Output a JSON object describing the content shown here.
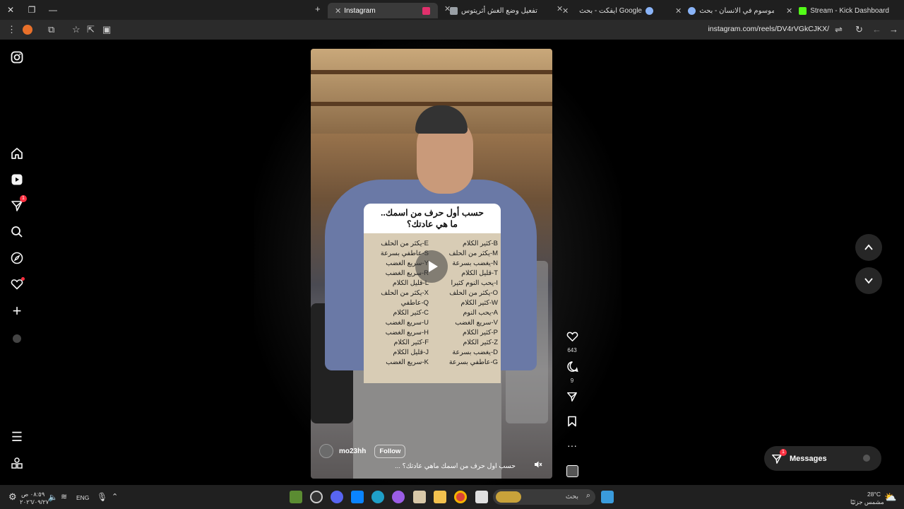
{
  "browser": {
    "tabs": [
      {
        "label": "Stream - Kick Dashboard",
        "color": "#53fc18"
      },
      {
        "label": "كم كروموسوم في الانسان - بحث",
        "color": "#8ab4f8"
      },
      {
        "label": "ايفكت - بحث Google",
        "color": "#8ab4f8"
      },
      {
        "label": "تفعيل وضع الغش أثريتوس",
        "color": "#9aa0a6"
      },
      {
        "label": "Instagram",
        "color": "#e1306c"
      }
    ],
    "url": "instagram.com/reels/DV4rVGkCJKX/"
  },
  "nav": {
    "notifications_badge": "1"
  },
  "reel": {
    "card_title_line1": "حسب أول حرف من اسمك..",
    "card_title_line2": "ما هي عادتك؟",
    "right_column": [
      "B-كثير الكلام",
      "M-يكثر من الحلف",
      "N-يغضب بسرعة",
      "T-قليل الكلام",
      "I-يحب النوم كثيرا",
      "O-يكثر من الحلف",
      "W-كثير الكلام",
      "A-يحب النوم",
      "V-سريع الغضب",
      "P-كثير الكلام",
      "Z-كثير الكلام",
      "D-يغضب بسرعة",
      "G-عاطفي بسرعة"
    ],
    "left_column": [
      "E-يكثر من الحلف",
      "S-عاطفي بسرعة",
      "Y-سريع الغضب",
      "R-سريع الغضب",
      "L-قليل الكلام",
      "X-يكثر من الحلف",
      "Q-عاطفي",
      "C-كثير الكلام",
      "U-سريع الغضب",
      "H-سريع الغضب",
      "F-كثير الكلام",
      "J-قليل الكلام",
      "K-سريع الغضب"
    ],
    "author": "mo23hh",
    "follow_label": "Follow",
    "caption": "حسب اول حرف من اسمك ماهي عادتك؟ ...",
    "likes": "643",
    "comments": "9"
  },
  "messages": {
    "label": "Messages",
    "badge": "1"
  },
  "taskbar": {
    "time": "٠٨:٥٩ ص",
    "date": "٢٠٢٦/٠٩/٢٧",
    "lang": "ENG",
    "search_placeholder": "بحث",
    "weather_temp": "28°C",
    "weather_desc": "مشمس جزئيًا"
  }
}
